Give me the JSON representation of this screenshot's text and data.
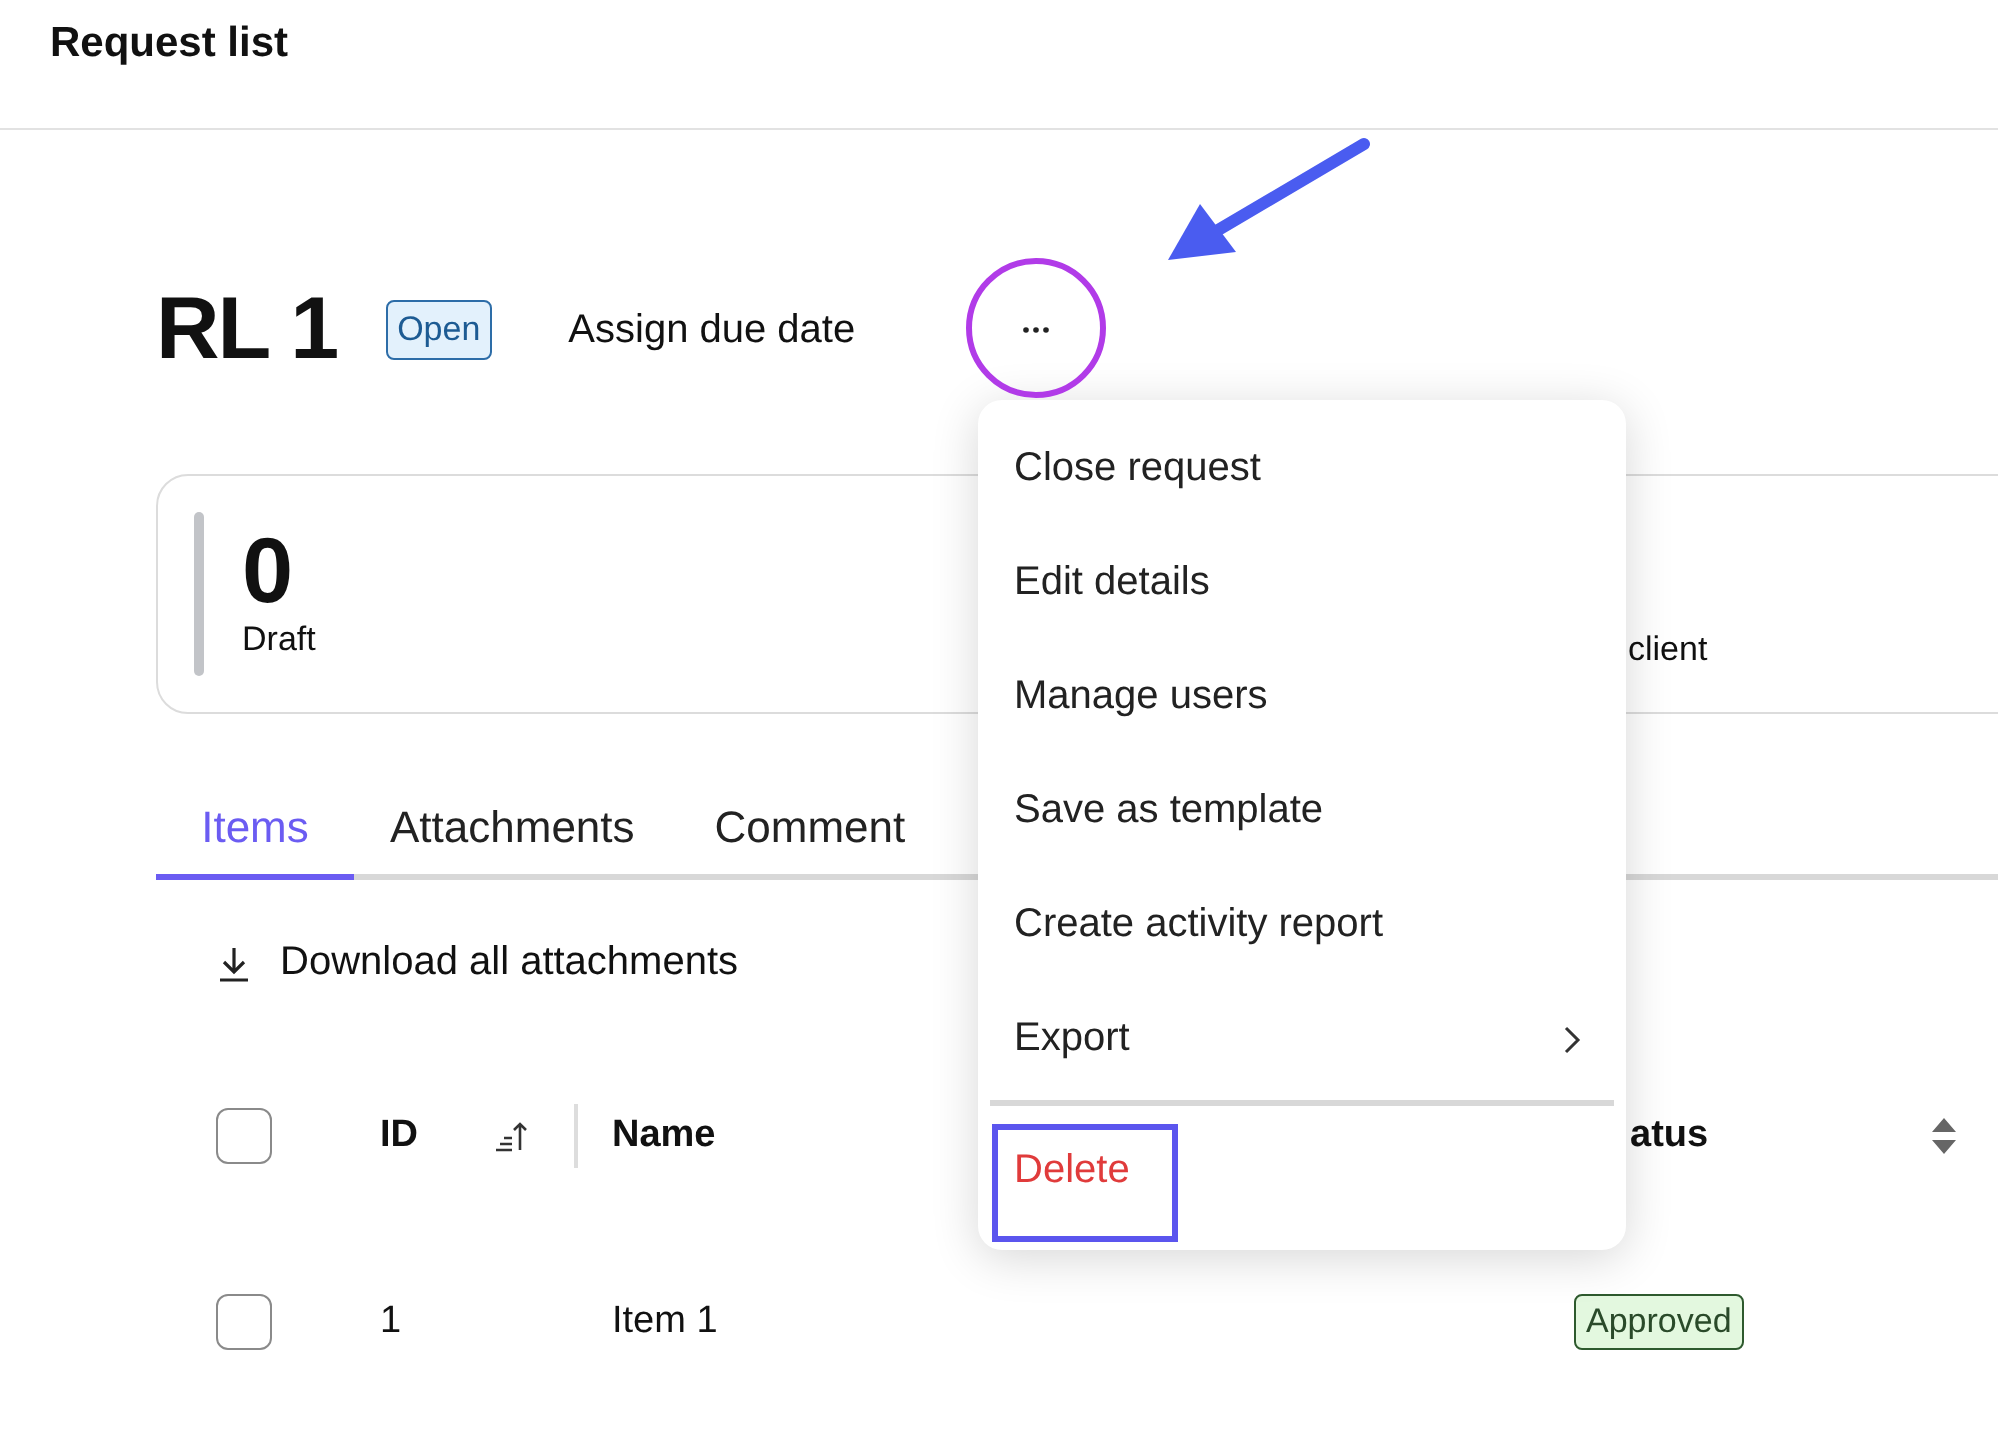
{
  "header": {
    "title": "Request list"
  },
  "request": {
    "title": "RL 1",
    "status": "Open",
    "due_date_link": "Assign due date"
  },
  "summary": {
    "stats": [
      {
        "count": "0",
        "label": "Draft"
      }
    ],
    "second_stat_label": "client"
  },
  "tabs": [
    {
      "label": "Items",
      "selected": true
    },
    {
      "label": "Attachments",
      "selected": false
    },
    {
      "label": "Comment",
      "selected": false
    }
  ],
  "download_link": "Download all attachments",
  "table": {
    "select_all_checked": false,
    "columns": [
      "ID",
      "Name",
      "atus"
    ],
    "rows": [
      {
        "checked": false,
        "id": "1",
        "name": "Item 1",
        "status": "Approved"
      }
    ]
  },
  "menu": {
    "items": [
      {
        "label": "Close request",
        "kind": "action"
      },
      {
        "label": "Edit details",
        "kind": "action"
      },
      {
        "label": "Manage users",
        "kind": "action"
      },
      {
        "label": "Save as template",
        "kind": "action"
      },
      {
        "label": "Create activity report",
        "kind": "action"
      },
      {
        "label": "Export",
        "kind": "submenu"
      },
      {
        "label": "Delete",
        "kind": "danger"
      }
    ]
  }
}
